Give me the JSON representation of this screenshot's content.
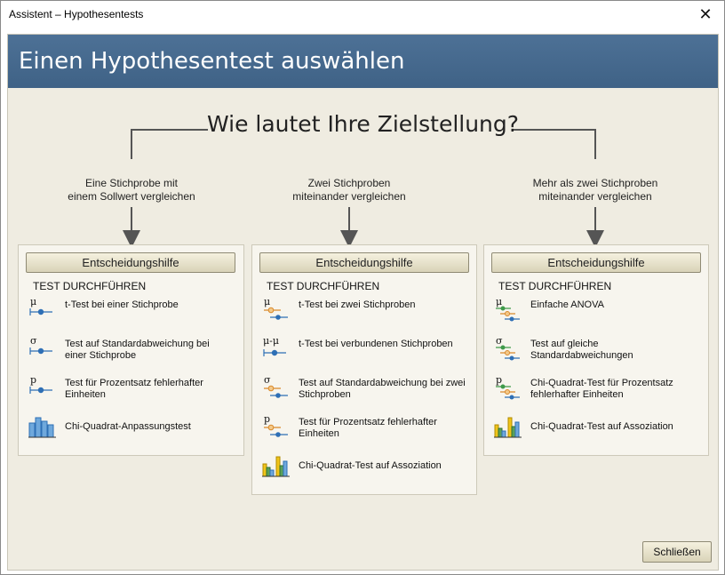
{
  "window": {
    "title": "Assistent – Hypothesentests",
    "close_glyph": "✕"
  },
  "header": {
    "title": "Einen Hypothesentest auswählen"
  },
  "question": "Wie lautet Ihre Zielstellung?",
  "columns": [
    {
      "goal_line1": "Eine Stichprobe mit",
      "goal_line2": "einem Sollwert vergleichen",
      "decision_label": "Entscheidungshilfe",
      "section_title": "TEST DURCHFÜHREN",
      "tests": [
        {
          "symbol": "μ",
          "icon": "one-sample-interval-icon",
          "label": "t-Test bei einer Stichprobe"
        },
        {
          "symbol": "σ",
          "icon": "one-sample-interval-icon",
          "label": "Test auf Standardabweichung bei einer Stichprobe"
        },
        {
          "symbol": "p",
          "icon": "one-sample-interval-icon",
          "label": "Test für Prozentsatz fehlerhafter Einheiten"
        },
        {
          "symbol": "",
          "icon": "goodness-of-fit-bars-icon",
          "label": "Chi-Quadrat-Anpassungstest"
        }
      ]
    },
    {
      "goal_line1": "Zwei Stichproben",
      "goal_line2": "miteinander vergleichen",
      "decision_label": "Entscheidungshilfe",
      "section_title": "TEST DURCHFÜHREN",
      "tests": [
        {
          "symbol": "μ",
          "icon": "two-sample-interval-icon",
          "label": "t-Test bei zwei Stichproben"
        },
        {
          "symbol": "μ-μ",
          "icon": "paired-interval-icon",
          "label": "t-Test bei verbundenen Stichproben"
        },
        {
          "symbol": "σ",
          "icon": "two-sample-interval-icon",
          "label": "Test auf Standardabweichung bei zwei Stichproben"
        },
        {
          "symbol": "p",
          "icon": "two-sample-interval-icon",
          "label": "Test für Prozentsatz fehlerhafter Einheiten"
        },
        {
          "symbol": "",
          "icon": "association-bars-icon",
          "label": "Chi-Quadrat-Test auf Assoziation"
        }
      ]
    },
    {
      "goal_line1": "Mehr als zwei Stichproben",
      "goal_line2": "miteinander vergleichen",
      "decision_label": "Entscheidungshilfe",
      "section_title": "TEST DURCHFÜHREN",
      "tests": [
        {
          "symbol": "μ",
          "icon": "multi-sample-interval-icon",
          "label": "Einfache ANOVA"
        },
        {
          "symbol": "σ",
          "icon": "multi-sample-interval-icon",
          "label": "Test auf gleiche Standardabweichungen"
        },
        {
          "symbol": "p",
          "icon": "multi-sample-interval-icon",
          "label": "Chi-Quadrat-Test für Prozentsatz fehlerhafter Einheiten"
        },
        {
          "symbol": "",
          "icon": "association-bars-icon",
          "label": "Chi-Quadrat-Test auf Assoziation"
        }
      ]
    }
  ],
  "footer": {
    "close_label": "Schließen"
  },
  "colors": {
    "header": "#456a8f",
    "background": "#efece1",
    "interval_blue": "#2e6fb5",
    "interval_orange": "#d9892a",
    "interval_green": "#3f9a4a",
    "bar_yellow": "#f0c419"
  }
}
